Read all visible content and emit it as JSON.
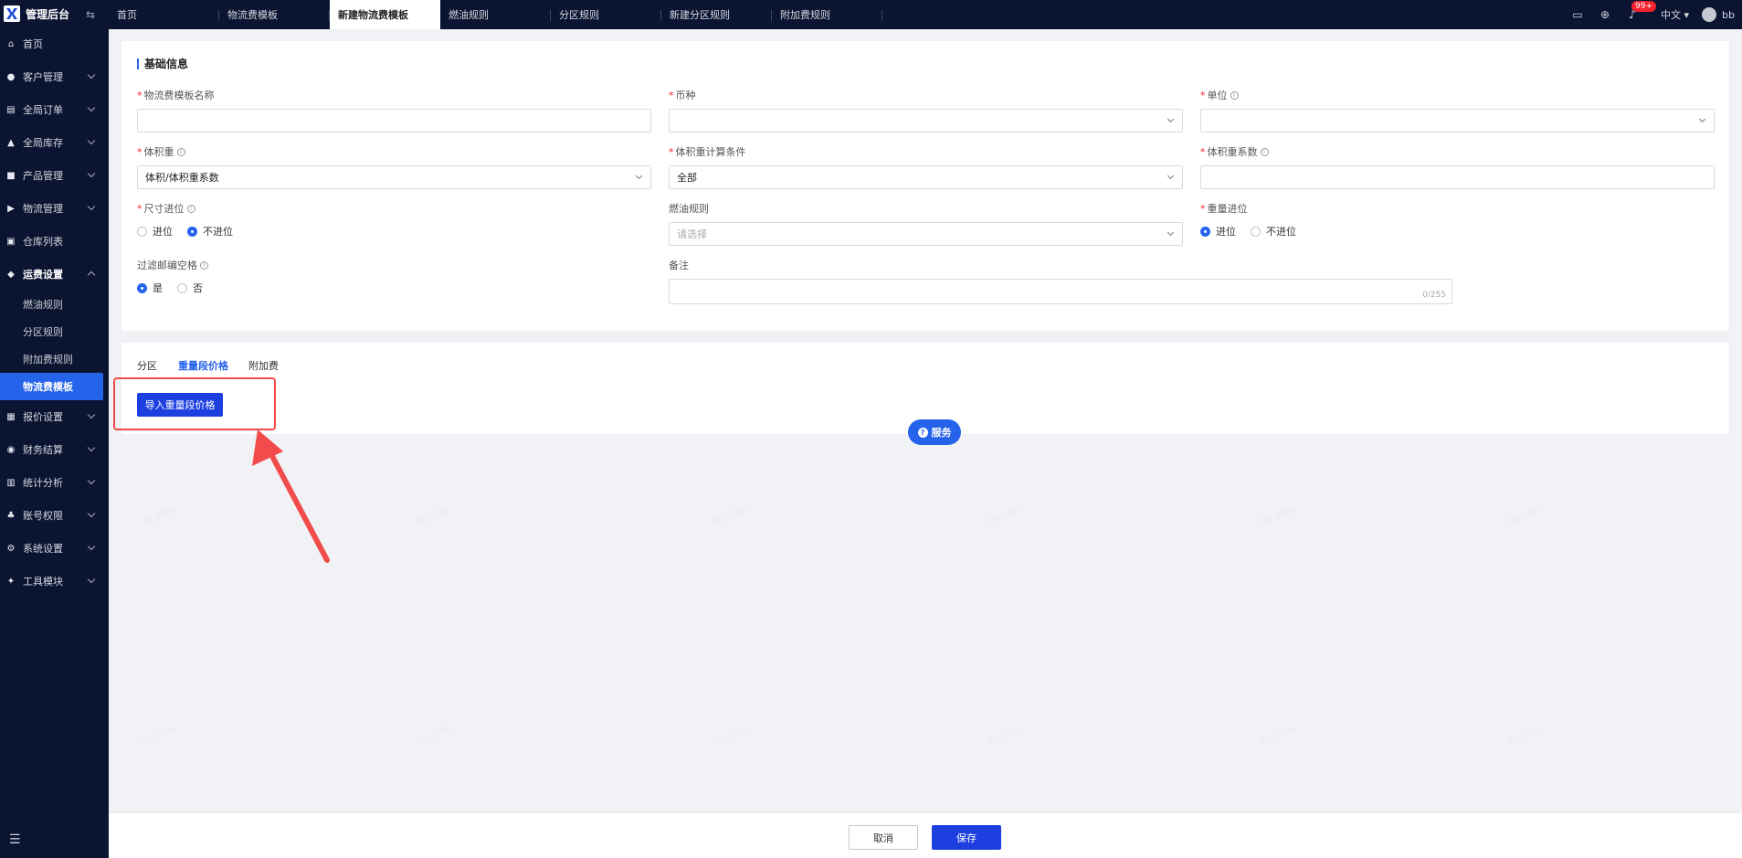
{
  "app": {
    "title": "管理后台"
  },
  "tabs": [
    {
      "label": "首页"
    },
    {
      "label": "物流费模板"
    },
    {
      "label": "新建物流费模板"
    },
    {
      "label": "燃油规则"
    },
    {
      "label": "分区规则"
    },
    {
      "label": "新建分区规则"
    },
    {
      "label": "附加费规则"
    }
  ],
  "header": {
    "badge": "99+",
    "lang": "中文",
    "user": "bb"
  },
  "sidebar": {
    "items": [
      {
        "label": "首页"
      },
      {
        "label": "客户管理"
      },
      {
        "label": "全局订单"
      },
      {
        "label": "全局库存"
      },
      {
        "label": "产品管理"
      },
      {
        "label": "物流管理"
      },
      {
        "label": "仓库列表"
      },
      {
        "label": "运费设置"
      },
      {
        "label": "报价设置"
      },
      {
        "label": "财务结算"
      },
      {
        "label": "统计分析"
      },
      {
        "label": "账号权限"
      },
      {
        "label": "系统设置"
      },
      {
        "label": "工具模块"
      }
    ],
    "subitems": [
      {
        "label": "燃油规则"
      },
      {
        "label": "分区规则"
      },
      {
        "label": "附加费规则"
      },
      {
        "label": "物流费模板"
      }
    ]
  },
  "form": {
    "section_title": "基础信息",
    "template_name_label": "物流费模板名称",
    "currency_label": "币种",
    "unit_label": "单位",
    "volume_weight_label": "体积重",
    "volume_weight_value": "体积/体积重系数",
    "volume_cond_label": "体积重计算条件",
    "volume_cond_value": "全部",
    "volume_coef_label": "体积重系数",
    "size_round_label": "尺寸进位",
    "size_round_opts": [
      "进位",
      "不进位"
    ],
    "fuel_label": "燃油规则",
    "fuel_placeholder": "请选择",
    "weight_round_label": "重量进位",
    "weight_round_opts": [
      "进位",
      "不进位"
    ],
    "filter_label": "过滤邮编空格",
    "filter_opts": [
      "是",
      "否"
    ],
    "remark_label": "备注",
    "remark_counter": "0/255"
  },
  "subtabs": [
    {
      "label": "分区"
    },
    {
      "label": "重量段价格"
    },
    {
      "label": "附加费"
    }
  ],
  "import_button": "导入重量段价格",
  "service_button": "服务",
  "footer": {
    "cancel": "取消",
    "save": "保存"
  },
  "watermark": "bb_1005",
  "colors": {
    "primary": "#1d3fe0",
    "sidebar_bg": "#0b1531",
    "highlight": "#f24b4b"
  }
}
